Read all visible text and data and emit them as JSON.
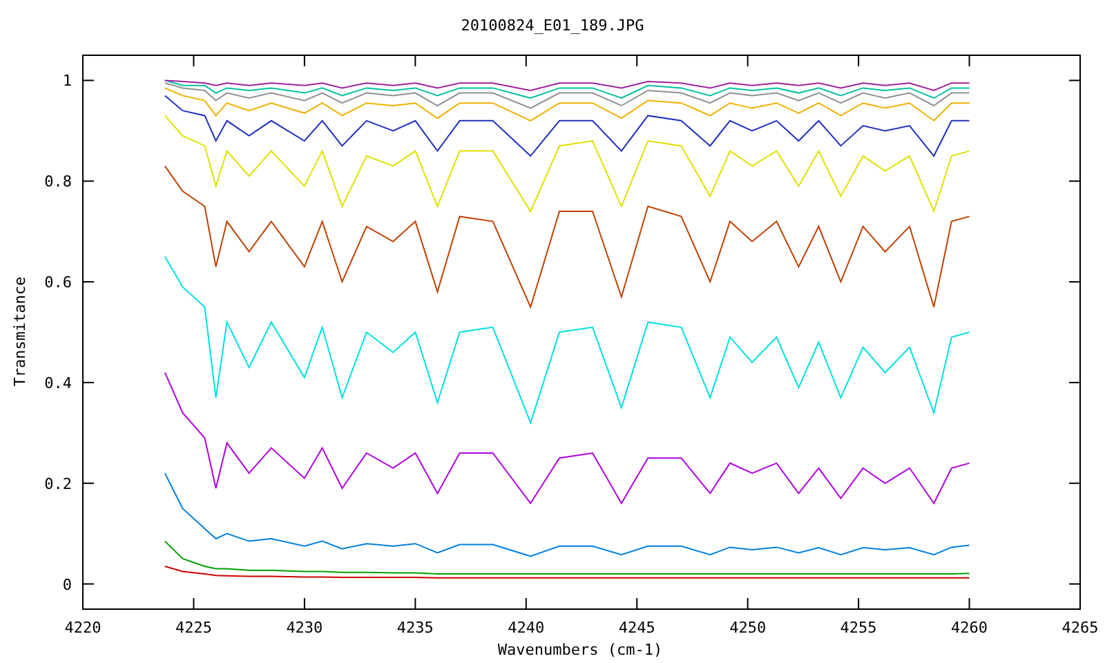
{
  "plot": {
    "chart_data": {
      "type": "line",
      "title": "20100824_E01_189.JPG",
      "xlabel": "Wavenumbers (cm-1)",
      "ylabel": "Transmitance",
      "x": [
        4223.7,
        4224.5,
        4225.5,
        4226,
        4226.5,
        4227.5,
        4228.5,
        4230,
        4230.8,
        4231.7,
        4232.8,
        4234,
        4235,
        4236,
        4237,
        4238.5,
        4240.2,
        4241.5,
        4243,
        4244.3,
        4245.5,
        4247,
        4248.3,
        4249.2,
        4250.2,
        4251.3,
        4252.3,
        4253.2,
        4254.2,
        4255.2,
        4256.2,
        4257.3,
        4258.4,
        4259.2,
        4260
      ],
      "xlim": [
        4220,
        4265
      ],
      "ylim": [
        -0.05,
        1.05
      ],
      "xticks": [
        4220,
        4225,
        4230,
        4235,
        4240,
        4245,
        4250,
        4255,
        4260,
        4265
      ],
      "yticks": [
        0,
        0.2,
        0.4,
        0.6,
        0.8,
        1
      ],
      "series": [
        {
          "color": "#cc0000",
          "values": [
            0.035,
            0.025,
            0.02,
            0.017,
            0.016,
            0.015,
            0.015,
            0.014,
            0.014,
            0.013,
            0.013,
            0.013,
            0.013,
            0.012,
            0.012,
            0.012,
            0.012,
            0.012,
            0.012,
            0.012,
            0.012,
            0.012,
            0.012,
            0.012,
            0.012,
            0.012,
            0.012,
            0.012,
            0.012,
            0.012,
            0.012,
            0.012,
            0.012,
            0.012,
            0.012
          ]
        },
        {
          "color": "#00a000",
          "values": [
            0.085,
            0.05,
            0.035,
            0.03,
            0.03,
            0.027,
            0.027,
            0.025,
            0.025,
            0.023,
            0.023,
            0.022,
            0.022,
            0.02,
            0.02,
            0.02,
            0.02,
            0.02,
            0.02,
            0.02,
            0.02,
            0.02,
            0.02,
            0.02,
            0.02,
            0.02,
            0.02,
            0.02,
            0.02,
            0.02,
            0.02,
            0.02,
            0.02,
            0.02,
            0.021
          ]
        },
        {
          "color": "#0080e0",
          "values": [
            0.22,
            0.15,
            0.11,
            0.09,
            0.1,
            0.085,
            0.09,
            0.075,
            0.085,
            0.07,
            0.08,
            0.075,
            0.08,
            0.062,
            0.078,
            0.078,
            0.055,
            0.075,
            0.075,
            0.058,
            0.075,
            0.075,
            0.058,
            0.073,
            0.068,
            0.073,
            0.062,
            0.072,
            0.058,
            0.072,
            0.068,
            0.072,
            0.058,
            0.073,
            0.077
          ]
        },
        {
          "color": "#b000e0",
          "values": [
            0.42,
            0.34,
            0.29,
            0.19,
            0.28,
            0.22,
            0.27,
            0.21,
            0.27,
            0.19,
            0.26,
            0.23,
            0.26,
            0.18,
            0.26,
            0.26,
            0.16,
            0.25,
            0.26,
            0.16,
            0.25,
            0.25,
            0.18,
            0.24,
            0.22,
            0.24,
            0.18,
            0.23,
            0.17,
            0.23,
            0.2,
            0.23,
            0.16,
            0.23,
            0.24
          ]
        },
        {
          "color": "#00e0e0",
          "values": [
            0.65,
            0.59,
            0.55,
            0.37,
            0.52,
            0.43,
            0.52,
            0.41,
            0.51,
            0.37,
            0.5,
            0.46,
            0.5,
            0.36,
            0.5,
            0.51,
            0.32,
            0.5,
            0.51,
            0.35,
            0.52,
            0.51,
            0.37,
            0.49,
            0.44,
            0.49,
            0.39,
            0.48,
            0.37,
            0.47,
            0.42,
            0.47,
            0.34,
            0.49,
            0.5
          ]
        },
        {
          "color": "#c04000",
          "values": [
            0.83,
            0.78,
            0.75,
            0.63,
            0.72,
            0.66,
            0.72,
            0.63,
            0.72,
            0.6,
            0.71,
            0.68,
            0.72,
            0.58,
            0.73,
            0.72,
            0.55,
            0.74,
            0.74,
            0.57,
            0.75,
            0.73,
            0.6,
            0.72,
            0.68,
            0.72,
            0.63,
            0.71,
            0.6,
            0.71,
            0.66,
            0.71,
            0.55,
            0.72,
            0.73
          ]
        },
        {
          "color": "#e0e000",
          "values": [
            0.93,
            0.89,
            0.87,
            0.79,
            0.86,
            0.81,
            0.86,
            0.79,
            0.86,
            0.75,
            0.85,
            0.83,
            0.86,
            0.75,
            0.86,
            0.86,
            0.74,
            0.87,
            0.88,
            0.75,
            0.88,
            0.87,
            0.77,
            0.86,
            0.83,
            0.86,
            0.79,
            0.86,
            0.77,
            0.85,
            0.82,
            0.85,
            0.74,
            0.85,
            0.86
          ]
        },
        {
          "color": "#2030c0",
          "values": [
            0.97,
            0.94,
            0.93,
            0.88,
            0.92,
            0.89,
            0.92,
            0.88,
            0.92,
            0.87,
            0.92,
            0.9,
            0.92,
            0.86,
            0.92,
            0.92,
            0.85,
            0.92,
            0.92,
            0.86,
            0.93,
            0.92,
            0.87,
            0.92,
            0.9,
            0.92,
            0.88,
            0.92,
            0.87,
            0.91,
            0.9,
            0.91,
            0.85,
            0.92,
            0.92
          ]
        },
        {
          "color": "#f0b000",
          "values": [
            0.985,
            0.97,
            0.96,
            0.93,
            0.955,
            0.94,
            0.955,
            0.935,
            0.955,
            0.93,
            0.955,
            0.95,
            0.955,
            0.925,
            0.955,
            0.955,
            0.92,
            0.955,
            0.955,
            0.925,
            0.96,
            0.955,
            0.93,
            0.955,
            0.945,
            0.955,
            0.935,
            0.955,
            0.93,
            0.955,
            0.945,
            0.955,
            0.92,
            0.955,
            0.955
          ]
        },
        {
          "color": "#909090",
          "values": [
            0.995,
            0.985,
            0.98,
            0.96,
            0.975,
            0.965,
            0.975,
            0.96,
            0.975,
            0.955,
            0.975,
            0.97,
            0.975,
            0.95,
            0.975,
            0.975,
            0.945,
            0.975,
            0.975,
            0.95,
            0.98,
            0.975,
            0.955,
            0.975,
            0.97,
            0.975,
            0.96,
            0.975,
            0.955,
            0.975,
            0.965,
            0.975,
            0.95,
            0.975,
            0.975
          ]
        },
        {
          "color": "#00c0a0",
          "values": [
            1,
            0.99,
            0.99,
            0.975,
            0.985,
            0.98,
            0.985,
            0.975,
            0.985,
            0.97,
            0.985,
            0.98,
            0.985,
            0.97,
            0.985,
            0.985,
            0.965,
            0.985,
            0.985,
            0.965,
            0.99,
            0.985,
            0.97,
            0.985,
            0.98,
            0.985,
            0.975,
            0.985,
            0.97,
            0.985,
            0.98,
            0.985,
            0.965,
            0.985,
            0.985
          ]
        },
        {
          "color": "#a020a0",
          "values": [
            1,
            0.998,
            0.995,
            0.99,
            0.995,
            0.99,
            0.995,
            0.99,
            0.995,
            0.985,
            0.995,
            0.99,
            0.995,
            0.985,
            0.995,
            0.995,
            0.98,
            0.995,
            0.995,
            0.985,
            0.998,
            0.995,
            0.985,
            0.995,
            0.99,
            0.995,
            0.99,
            0.995,
            0.985,
            0.995,
            0.99,
            0.995,
            0.98,
            0.995,
            0.995
          ]
        }
      ]
    }
  }
}
